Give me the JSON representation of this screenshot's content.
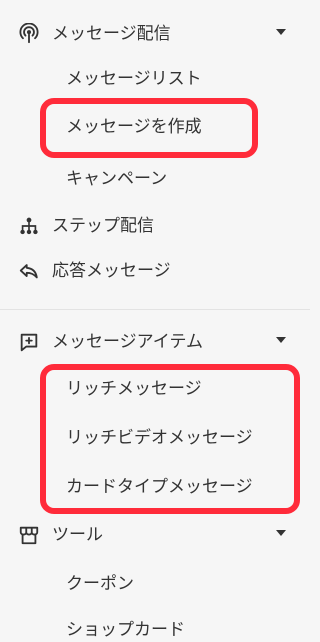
{
  "sidebar": {
    "message_delivery": {
      "label": "メッセージ配信",
      "icon": "broadcast-icon",
      "items": [
        {
          "label": "メッセージリスト"
        },
        {
          "label": "メッセージを作成"
        },
        {
          "label": "キャンペーン"
        }
      ]
    },
    "step_delivery": {
      "label": "ステップ配信",
      "icon": "hierarchy-icon"
    },
    "auto_reply": {
      "label": "応答メッセージ",
      "icon": "reply-icon"
    },
    "message_items": {
      "label": "メッセージアイテム",
      "icon": "add-box-icon",
      "items": [
        {
          "label": "リッチメッセージ"
        },
        {
          "label": "リッチビデオメッセージ"
        },
        {
          "label": "カードタイプメッセージ"
        }
      ]
    },
    "tools": {
      "label": "ツール",
      "icon": "store-icon",
      "items": [
        {
          "label": "クーポン"
        },
        {
          "label": "ショップカード"
        }
      ]
    }
  },
  "colors": {
    "background": "#f6f6f6",
    "text": "#333333",
    "highlight": "#ff2b3a",
    "divider": "#e3e3e3"
  }
}
